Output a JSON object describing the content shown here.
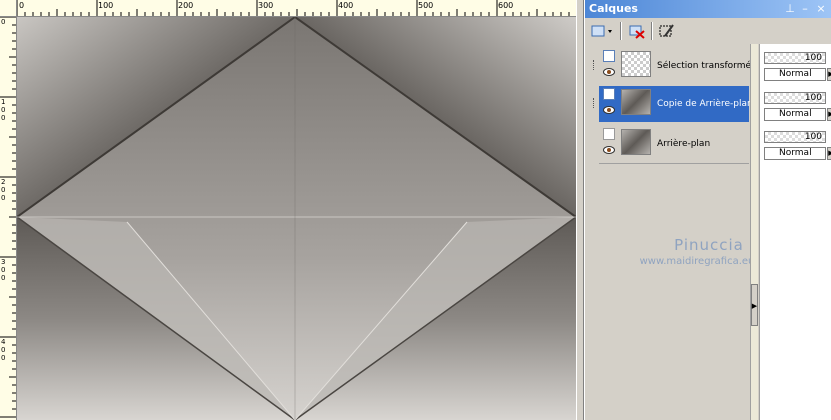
{
  "ruler": {
    "top_labels": [
      "0",
      "100",
      "200",
      "300",
      "400",
      "500",
      "600"
    ],
    "left_labels": [
      "0",
      "100",
      "200",
      "300",
      "400"
    ]
  },
  "palette": {
    "title": "Calques",
    "title_buttons": [
      "pin-icon",
      "minimize-icon",
      "close-icon"
    ],
    "layers": [
      {
        "name": "Sélection transformée",
        "selected": false,
        "type": "raster",
        "thumb": "pattern"
      },
      {
        "name": "Copie de Arrière-plan",
        "selected": true,
        "type": "raster",
        "thumb": "pattern"
      },
      {
        "name": "Arrière-plan",
        "selected": false,
        "type": "background",
        "thumb": "pattern"
      }
    ],
    "properties": [
      {
        "opacity": "100",
        "blend": "Normal"
      },
      {
        "opacity": "100",
        "blend": "Normal"
      },
      {
        "opacity": "100",
        "blend": "Normal"
      }
    ],
    "watermark": {
      "name": "Pinuccia",
      "url": "www.maidiregrafica.eu"
    }
  },
  "colors": {
    "selection": "#316ac5",
    "titlebar": "#4c86d6",
    "ruler": "#fffde6"
  }
}
